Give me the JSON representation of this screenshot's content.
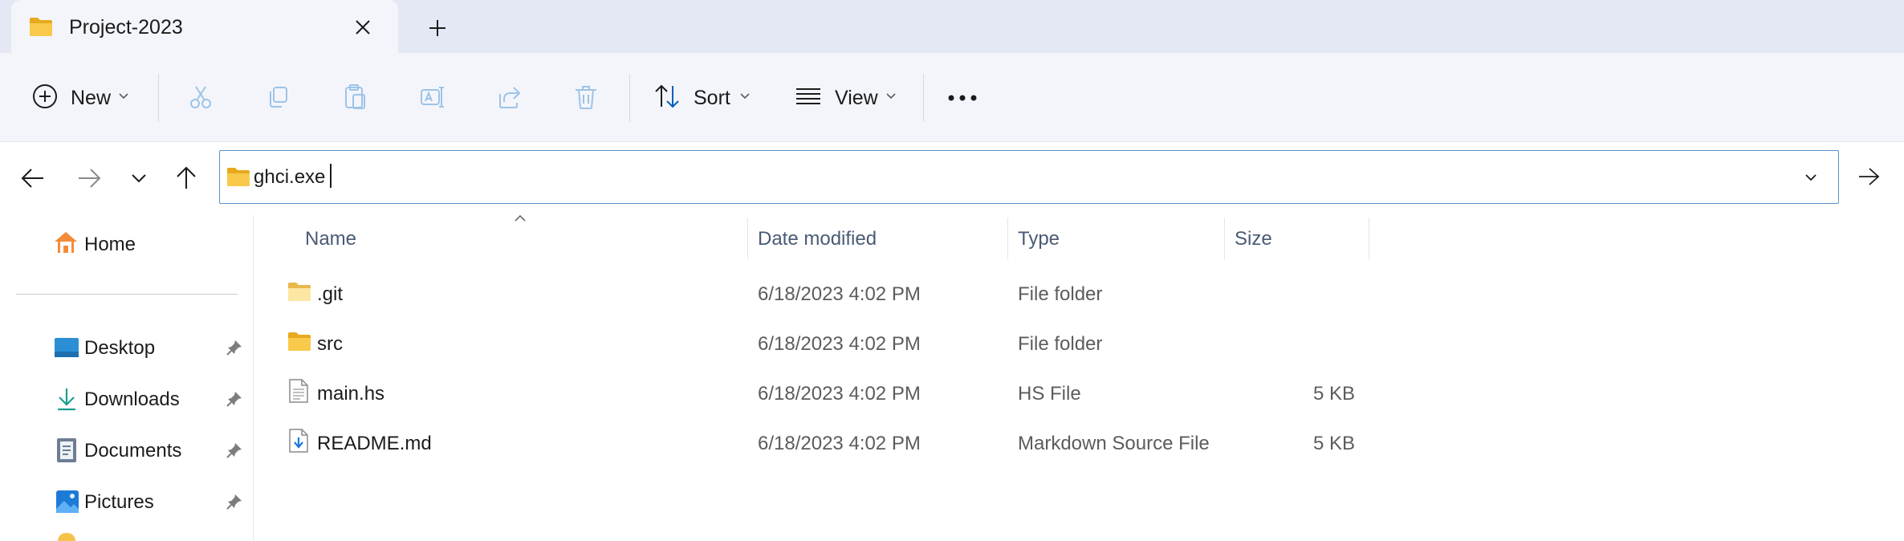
{
  "tab": {
    "title": "Project-2023"
  },
  "toolbar": {
    "new_label": "New",
    "sort_label": "Sort",
    "view_label": "View"
  },
  "address": {
    "value": "ghci.exe"
  },
  "sidebar": {
    "home_label": "Home",
    "quick_access": [
      {
        "label": "Desktop"
      },
      {
        "label": "Downloads"
      },
      {
        "label": "Documents"
      },
      {
        "label": "Pictures"
      }
    ]
  },
  "columns": {
    "name": "Name",
    "date": "Date modified",
    "type": "Type",
    "size": "Size"
  },
  "files": [
    {
      "name": ".git",
      "date": "6/18/2023 4:02 PM",
      "type": "File folder",
      "size": "",
      "icon": "folder-icon"
    },
    {
      "name": "src",
      "date": "6/18/2023 4:02 PM",
      "type": "File folder",
      "size": "",
      "icon": "folder-icon"
    },
    {
      "name": "main.hs",
      "date": "6/18/2023 4:02 PM",
      "type": "HS File",
      "size": "5 KB",
      "icon": "text-file-icon"
    },
    {
      "name": "README.md",
      "date": "6/18/2023 4:02 PM",
      "type": "Markdown Source File",
      "size": "5 KB",
      "icon": "markdown-file-icon"
    }
  ],
  "colors": {
    "accent": "#005fb8",
    "folder": "#f8c94b",
    "tabbar": "#e3e8f4",
    "commandbar": "#f3f5fb"
  }
}
